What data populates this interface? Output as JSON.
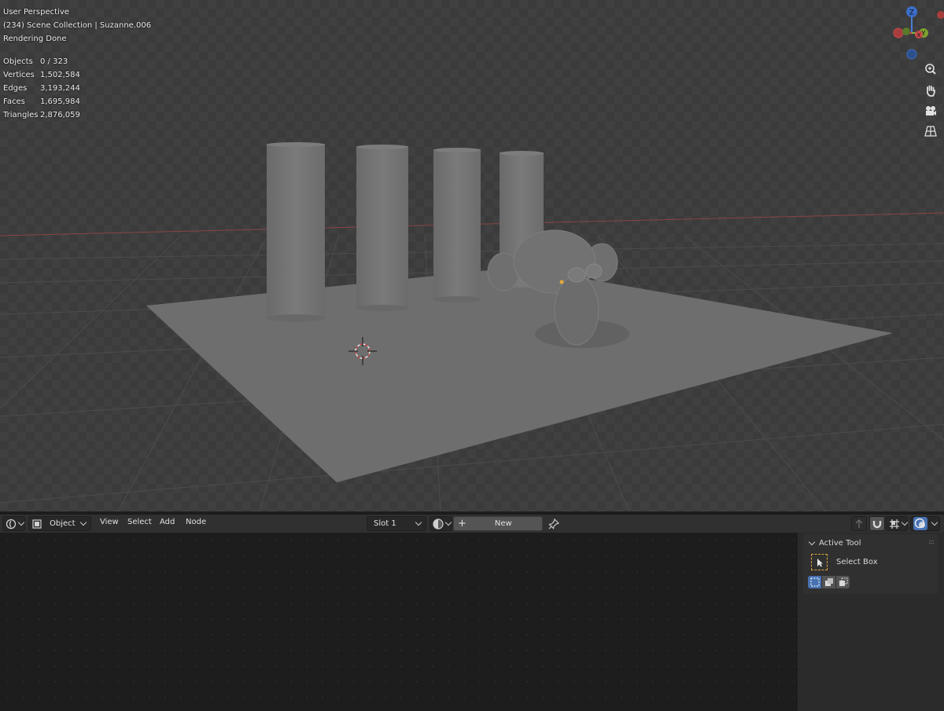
{
  "viewport": {
    "view_name": "User Perspective",
    "collection_line": "(234) Scene Collection | Suzanne.006",
    "status": "Rendering Done",
    "stats": [
      {
        "label": "Objects",
        "value": "0 / 323"
      },
      {
        "label": "Vertices",
        "value": "1,502,584"
      },
      {
        "label": "Edges",
        "value": "3,193,244"
      },
      {
        "label": "Faces",
        "value": "1,695,984"
      },
      {
        "label": "Triangles",
        "value": "2,876,059"
      }
    ],
    "gizmo": {
      "z_label": "Z",
      "y_label": "Y",
      "x_label": "X"
    },
    "nav_icons": [
      "zoom-icon",
      "pan-hand-icon",
      "camera-icon",
      "grid-perspective-icon"
    ]
  },
  "header": {
    "editor_type_icon": "node-editor-icon",
    "mode": "Object",
    "menus": [
      "View",
      "Select",
      "Add",
      "Node"
    ],
    "slot": "Slot 1",
    "new_label": "New",
    "new_plus": "+",
    "colors": {
      "active_toggle": "#4772b3"
    }
  },
  "sidebar": {
    "panel_title": "Active Tool",
    "tool_name": "Select Box",
    "grip": "::::"
  }
}
